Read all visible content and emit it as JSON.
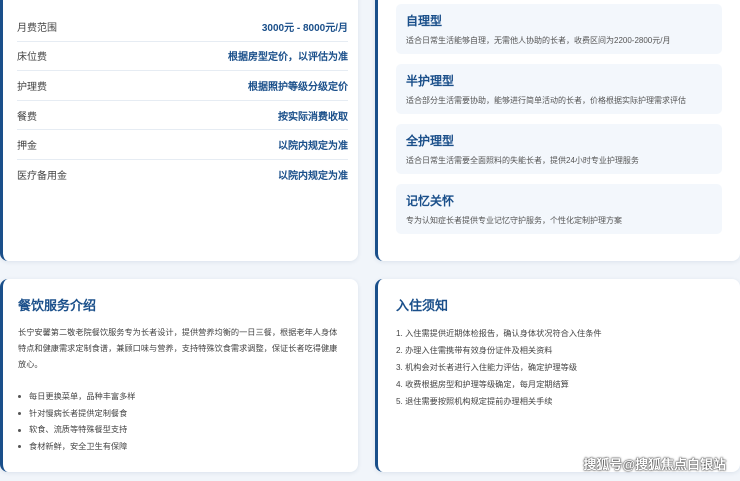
{
  "fees": {
    "rows": [
      {
        "label": "月费范围",
        "value": "3000元 - 8000元/月"
      },
      {
        "label": "床位费",
        "value": "根据房型定价，以评估为准"
      },
      {
        "label": "护理费",
        "value": "根据照护等级分级定价"
      },
      {
        "label": "餐费",
        "value": "按实际消费收取"
      },
      {
        "label": "押金",
        "value": "以院内规定为准"
      },
      {
        "label": "医疗备用金",
        "value": "以院内规定为准"
      }
    ]
  },
  "care_types": [
    {
      "title": "自理型",
      "desc": "适合日常生活能够自理，无需他人协助的长者，收费区间为2200-2800元/月"
    },
    {
      "title": "半护理型",
      "desc": "适合部分生活需要协助，能够进行简单活动的长者，价格根据实际护理需求评估"
    },
    {
      "title": "全护理型",
      "desc": "适合日常生活需要全面照料的失能长者，提供24小时专业护理服务"
    },
    {
      "title": "记忆关怀",
      "desc": "专为认知症长者提供专业记忆守护服务，个性化定制护理方案"
    }
  ],
  "food": {
    "title": "餐饮服务介绍",
    "intro": "长宁安馨第二敬老院餐饮服务专为长者设计，提供营养均衡的一日三餐，根据老年人身体特点和健康需求定制食谱，兼顾口味与营养，支持特殊饮食需求调整，保证长者吃得健康放心。",
    "items": [
      "每日更换菜单，品种丰富多样",
      "针对慢病长者提供定制餐食",
      "软食、流质等特殊餐型支持",
      "食材新鲜，安全卫生有保障"
    ]
  },
  "admission": {
    "title": "入住须知",
    "items": [
      "1. 入住需提供近期体检报告，确认身体状况符合入住条件",
      "2. 办理入住需携带有效身份证件及相关资料",
      "3. 机构会对长者进行入住能力评估，确定护理等级",
      "4. 收费根据房型和护理等级确定，每月定期结算",
      "5. 退住需要按照机构规定提前办理相关手续"
    ]
  },
  "watermark": "搜狐号@搜狐焦点白银站"
}
